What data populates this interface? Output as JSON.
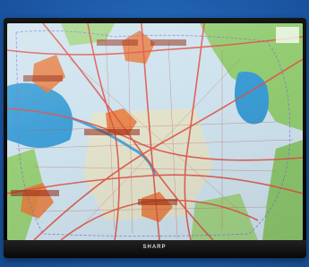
{
  "photo": {
    "subject": "",
    "device_brand": "SHARP",
    "colors": {
      "background": "#1f5fae",
      "bezel": "#0b0b0b",
      "map_base": "#c9e1ef",
      "water": "#3da0d8",
      "green": "#8fca6f",
      "roads": "#e35a4a",
      "zone_marker": "#e8793a"
    }
  },
  "map": {
    "zone_labels": [
      {
        "text": "",
        "name": "zone-label-north-1"
      },
      {
        "text": "",
        "name": "zone-label-north-2"
      },
      {
        "text": "",
        "name": "zone-label-west"
      },
      {
        "text": "",
        "name": "zone-label-center"
      },
      {
        "text": "",
        "name": "zone-label-southwest"
      },
      {
        "text": "",
        "name": "zone-label-south"
      }
    ]
  }
}
